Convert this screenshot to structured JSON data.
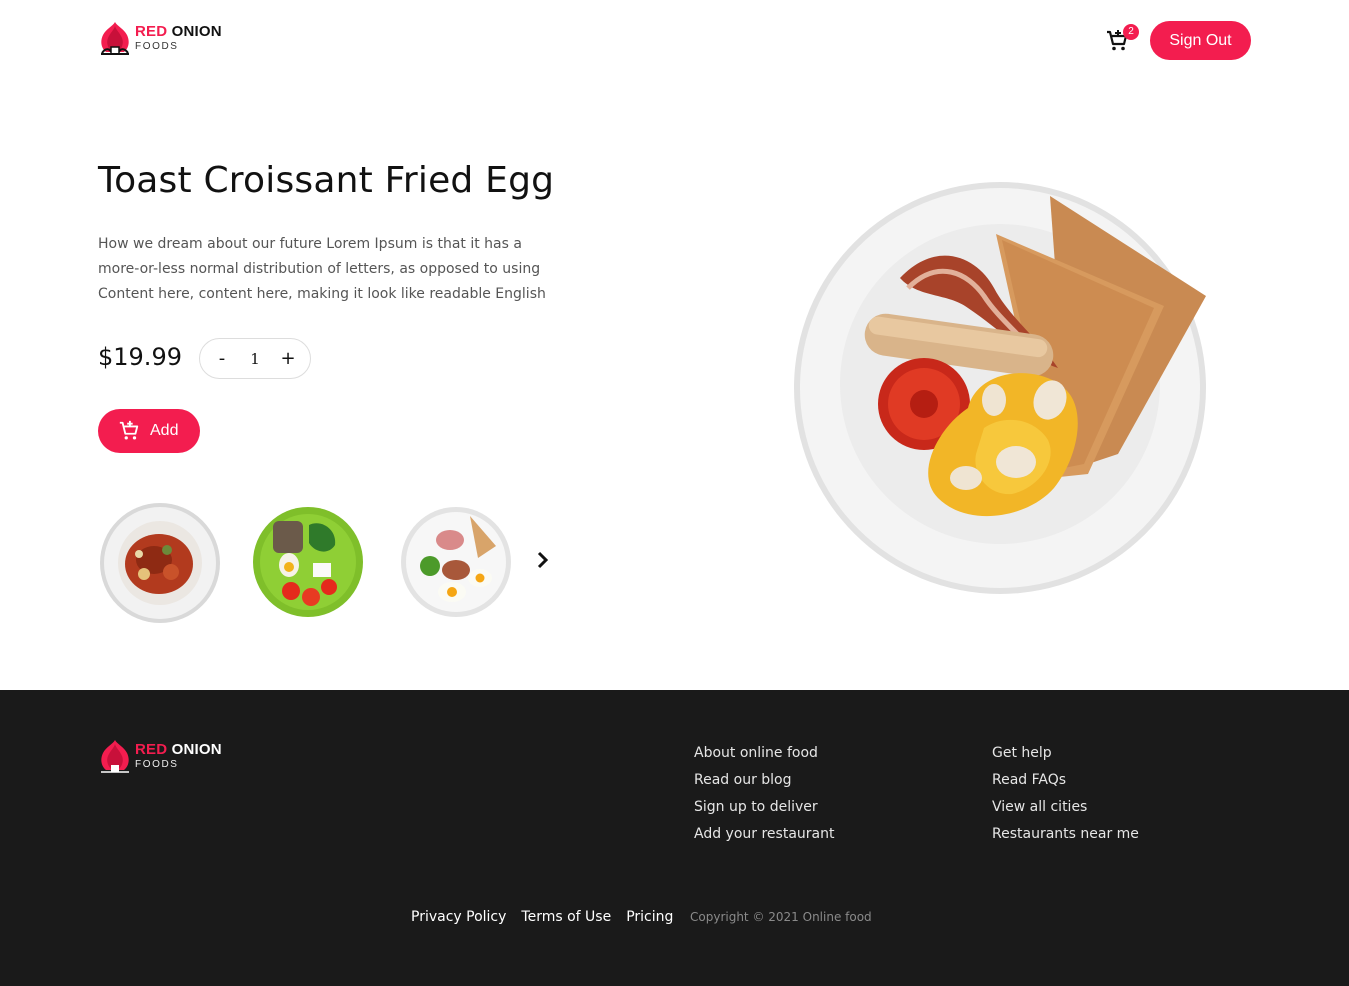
{
  "brand": {
    "name_red": "RED",
    "name_dark": "ONION",
    "tagline": "FOODS",
    "accent_color": "#f31d4f"
  },
  "header": {
    "cart_icon": "cart-icon",
    "cart_count": "2",
    "sign_out_label": "Sign Out"
  },
  "product": {
    "title": "Toast Croissant Fried Egg",
    "description": "How we dream about our future Lorem Ipsum is that it has a more-or-less normal distribution of letters, as opposed to using Content here, content here, making it look like readable English",
    "price": "$19.99",
    "quantity": "1",
    "decrement_label": "-",
    "increment_label": "+",
    "add_label": "Add",
    "add_icon": "add-to-cart-icon"
  },
  "gallery": {
    "next_icon": "chevron-right-icon"
  },
  "footer": {
    "col1": [
      "About online food",
      "Read our blog",
      "Sign up to deliver",
      "Add your restaurant"
    ],
    "col2": [
      "Get help",
      "Read FAQs",
      "View all cities",
      "Restaurants near me"
    ],
    "links": [
      "Privacy Policy",
      "Terms of Use",
      "Pricing"
    ],
    "copyright": "Copyright © 2021 Online food"
  }
}
